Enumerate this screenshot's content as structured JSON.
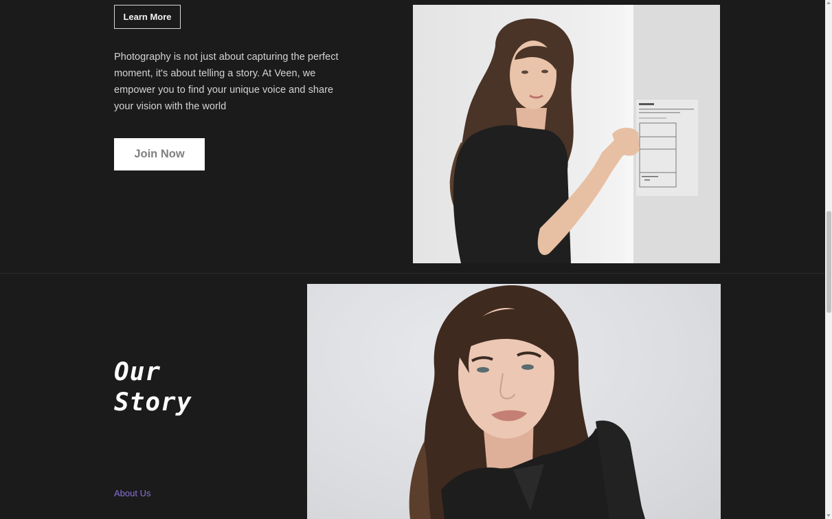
{
  "hero": {
    "learn_more_label": "Learn More",
    "description": "Photography is not just about capturing the perfect moment, it's about telling a story. At Veen, we empower you to find your unique voice and share your vision with the world",
    "join_now_label": "Join Now"
  },
  "story": {
    "heading_line1": "Our",
    "heading_line2": "Story",
    "about_link_label": "About Us"
  },
  "colors": {
    "background": "#1b1b1b",
    "link_accent": "#8b72d8",
    "button_primary_bg": "#ffffff",
    "button_primary_text": "#7f7f7f"
  }
}
